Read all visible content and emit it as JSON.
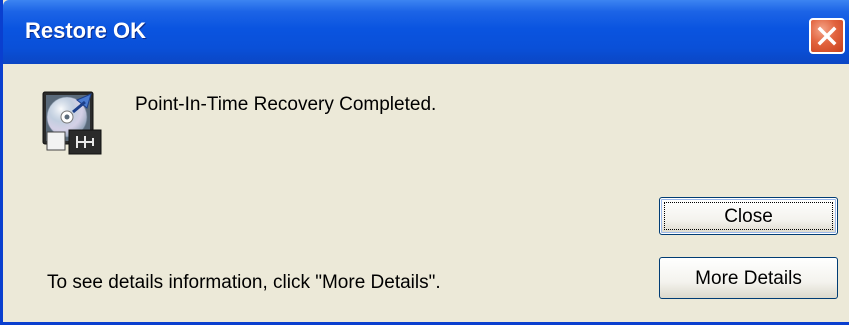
{
  "window": {
    "title": "Restore OK"
  },
  "icons": {
    "close": "close-icon",
    "app": "disk-recovery-icon"
  },
  "message": "Point-In-Time Recovery Completed.",
  "buttons": {
    "close_label": "Close",
    "more_details_label": "More Details"
  },
  "footer": {
    "hint": "To see details information, click \"More Details\"."
  },
  "colors": {
    "titlebar": "#0a54e0",
    "window_bg": "#ece9d8",
    "close_button": "#e2643f",
    "button_border": "#003c74"
  }
}
